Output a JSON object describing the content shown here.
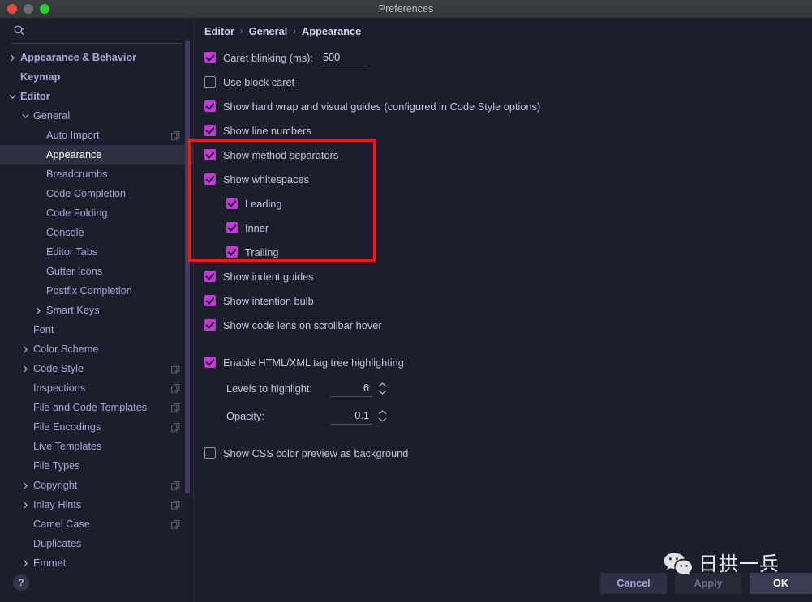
{
  "window": {
    "title": "Preferences",
    "controls": [
      "close",
      "minimize",
      "zoom"
    ]
  },
  "sidebar": {
    "search": {
      "value": "",
      "placeholder": ""
    },
    "items": [
      {
        "label": "Appearance & Behavior",
        "depth": 0,
        "arrow": "right",
        "bold": true,
        "selected": false,
        "copy": false
      },
      {
        "label": "Keymap",
        "depth": 0,
        "arrow": "none",
        "bold": true,
        "selected": false,
        "copy": false
      },
      {
        "label": "Editor",
        "depth": 0,
        "arrow": "down",
        "bold": true,
        "selected": false,
        "copy": false
      },
      {
        "label": "General",
        "depth": 1,
        "arrow": "down",
        "bold": false,
        "selected": false,
        "copy": false
      },
      {
        "label": "Auto Import",
        "depth": 2,
        "arrow": "none",
        "bold": false,
        "selected": false,
        "copy": true
      },
      {
        "label": "Appearance",
        "depth": 2,
        "arrow": "none",
        "bold": false,
        "selected": true,
        "copy": false
      },
      {
        "label": "Breadcrumbs",
        "depth": 2,
        "arrow": "none",
        "bold": false,
        "selected": false,
        "copy": false
      },
      {
        "label": "Code Completion",
        "depth": 2,
        "arrow": "none",
        "bold": false,
        "selected": false,
        "copy": false
      },
      {
        "label": "Code Folding",
        "depth": 2,
        "arrow": "none",
        "bold": false,
        "selected": false,
        "copy": false
      },
      {
        "label": "Console",
        "depth": 2,
        "arrow": "none",
        "bold": false,
        "selected": false,
        "copy": false
      },
      {
        "label": "Editor Tabs",
        "depth": 2,
        "arrow": "none",
        "bold": false,
        "selected": false,
        "copy": false
      },
      {
        "label": "Gutter Icons",
        "depth": 2,
        "arrow": "none",
        "bold": false,
        "selected": false,
        "copy": false
      },
      {
        "label": "Postfix Completion",
        "depth": 2,
        "arrow": "none",
        "bold": false,
        "selected": false,
        "copy": false
      },
      {
        "label": "Smart Keys",
        "depth": 2,
        "arrow": "right",
        "bold": false,
        "selected": false,
        "copy": false
      },
      {
        "label": "Font",
        "depth": 1,
        "arrow": "none",
        "bold": false,
        "selected": false,
        "copy": false
      },
      {
        "label": "Color Scheme",
        "depth": 1,
        "arrow": "right",
        "bold": false,
        "selected": false,
        "copy": false
      },
      {
        "label": "Code Style",
        "depth": 1,
        "arrow": "right",
        "bold": false,
        "selected": false,
        "copy": true
      },
      {
        "label": "Inspections",
        "depth": 1,
        "arrow": "none",
        "bold": false,
        "selected": false,
        "copy": true
      },
      {
        "label": "File and Code Templates",
        "depth": 1,
        "arrow": "none",
        "bold": false,
        "selected": false,
        "copy": true
      },
      {
        "label": "File Encodings",
        "depth": 1,
        "arrow": "none",
        "bold": false,
        "selected": false,
        "copy": true
      },
      {
        "label": "Live Templates",
        "depth": 1,
        "arrow": "none",
        "bold": false,
        "selected": false,
        "copy": false
      },
      {
        "label": "File Types",
        "depth": 1,
        "arrow": "none",
        "bold": false,
        "selected": false,
        "copy": false
      },
      {
        "label": "Copyright",
        "depth": 1,
        "arrow": "right",
        "bold": false,
        "selected": false,
        "copy": true
      },
      {
        "label": "Inlay Hints",
        "depth": 1,
        "arrow": "right",
        "bold": false,
        "selected": false,
        "copy": true
      },
      {
        "label": "Camel Case",
        "depth": 1,
        "arrow": "none",
        "bold": false,
        "selected": false,
        "copy": true
      },
      {
        "label": "Duplicates",
        "depth": 1,
        "arrow": "none",
        "bold": false,
        "selected": false,
        "copy": false
      },
      {
        "label": "Emmet",
        "depth": 1,
        "arrow": "right",
        "bold": false,
        "selected": false,
        "copy": false
      }
    ],
    "help_label": "?"
  },
  "main": {
    "breadcrumb": [
      "Editor",
      "General",
      "Appearance"
    ],
    "breadcrumb_separator": "›",
    "caret_blinking": {
      "label": "Caret blinking (ms):",
      "checked": true,
      "value": "500"
    },
    "checkboxes": [
      {
        "label": "Use block caret",
        "checked": false,
        "indent": false
      },
      {
        "label": "Show hard wrap and visual guides (configured in Code Style options)",
        "checked": true,
        "indent": false
      },
      {
        "label": "Show line numbers",
        "checked": true,
        "indent": false
      },
      {
        "label": "Show method separators",
        "checked": true,
        "indent": false
      },
      {
        "label": "Show whitespaces",
        "checked": true,
        "indent": false
      },
      {
        "label": "Leading",
        "checked": true,
        "indent": true
      },
      {
        "label": "Inner",
        "checked": true,
        "indent": true
      },
      {
        "label": "Trailing",
        "checked": true,
        "indent": true
      },
      {
        "label": "Show indent guides",
        "checked": true,
        "indent": false
      },
      {
        "label": "Show intention bulb",
        "checked": true,
        "indent": false
      },
      {
        "label": "Show code lens on scrollbar hover",
        "checked": true,
        "indent": false
      }
    ],
    "html_tag_tree": {
      "label": "Enable HTML/XML tag tree highlighting",
      "checked": true,
      "levels_label": "Levels to highlight:",
      "levels_value": "6",
      "opacity_label": "Opacity:",
      "opacity_value": "0.1"
    },
    "css_preview": {
      "label": "Show CSS color preview as background",
      "checked": false
    }
  },
  "footer": {
    "cancel": "Cancel",
    "apply": "Apply",
    "ok": "OK"
  },
  "watermark": {
    "text": "日拱一兵",
    "icon": "wechat-icon"
  },
  "colors": {
    "background": "#1d1e2b",
    "checkbox_accent": "#c23ad6",
    "annotation_red": "#ef1b1b",
    "sidebar_text": "#a9a7d8",
    "selection": "#2f3043",
    "scrollbar": "#433a5e"
  }
}
